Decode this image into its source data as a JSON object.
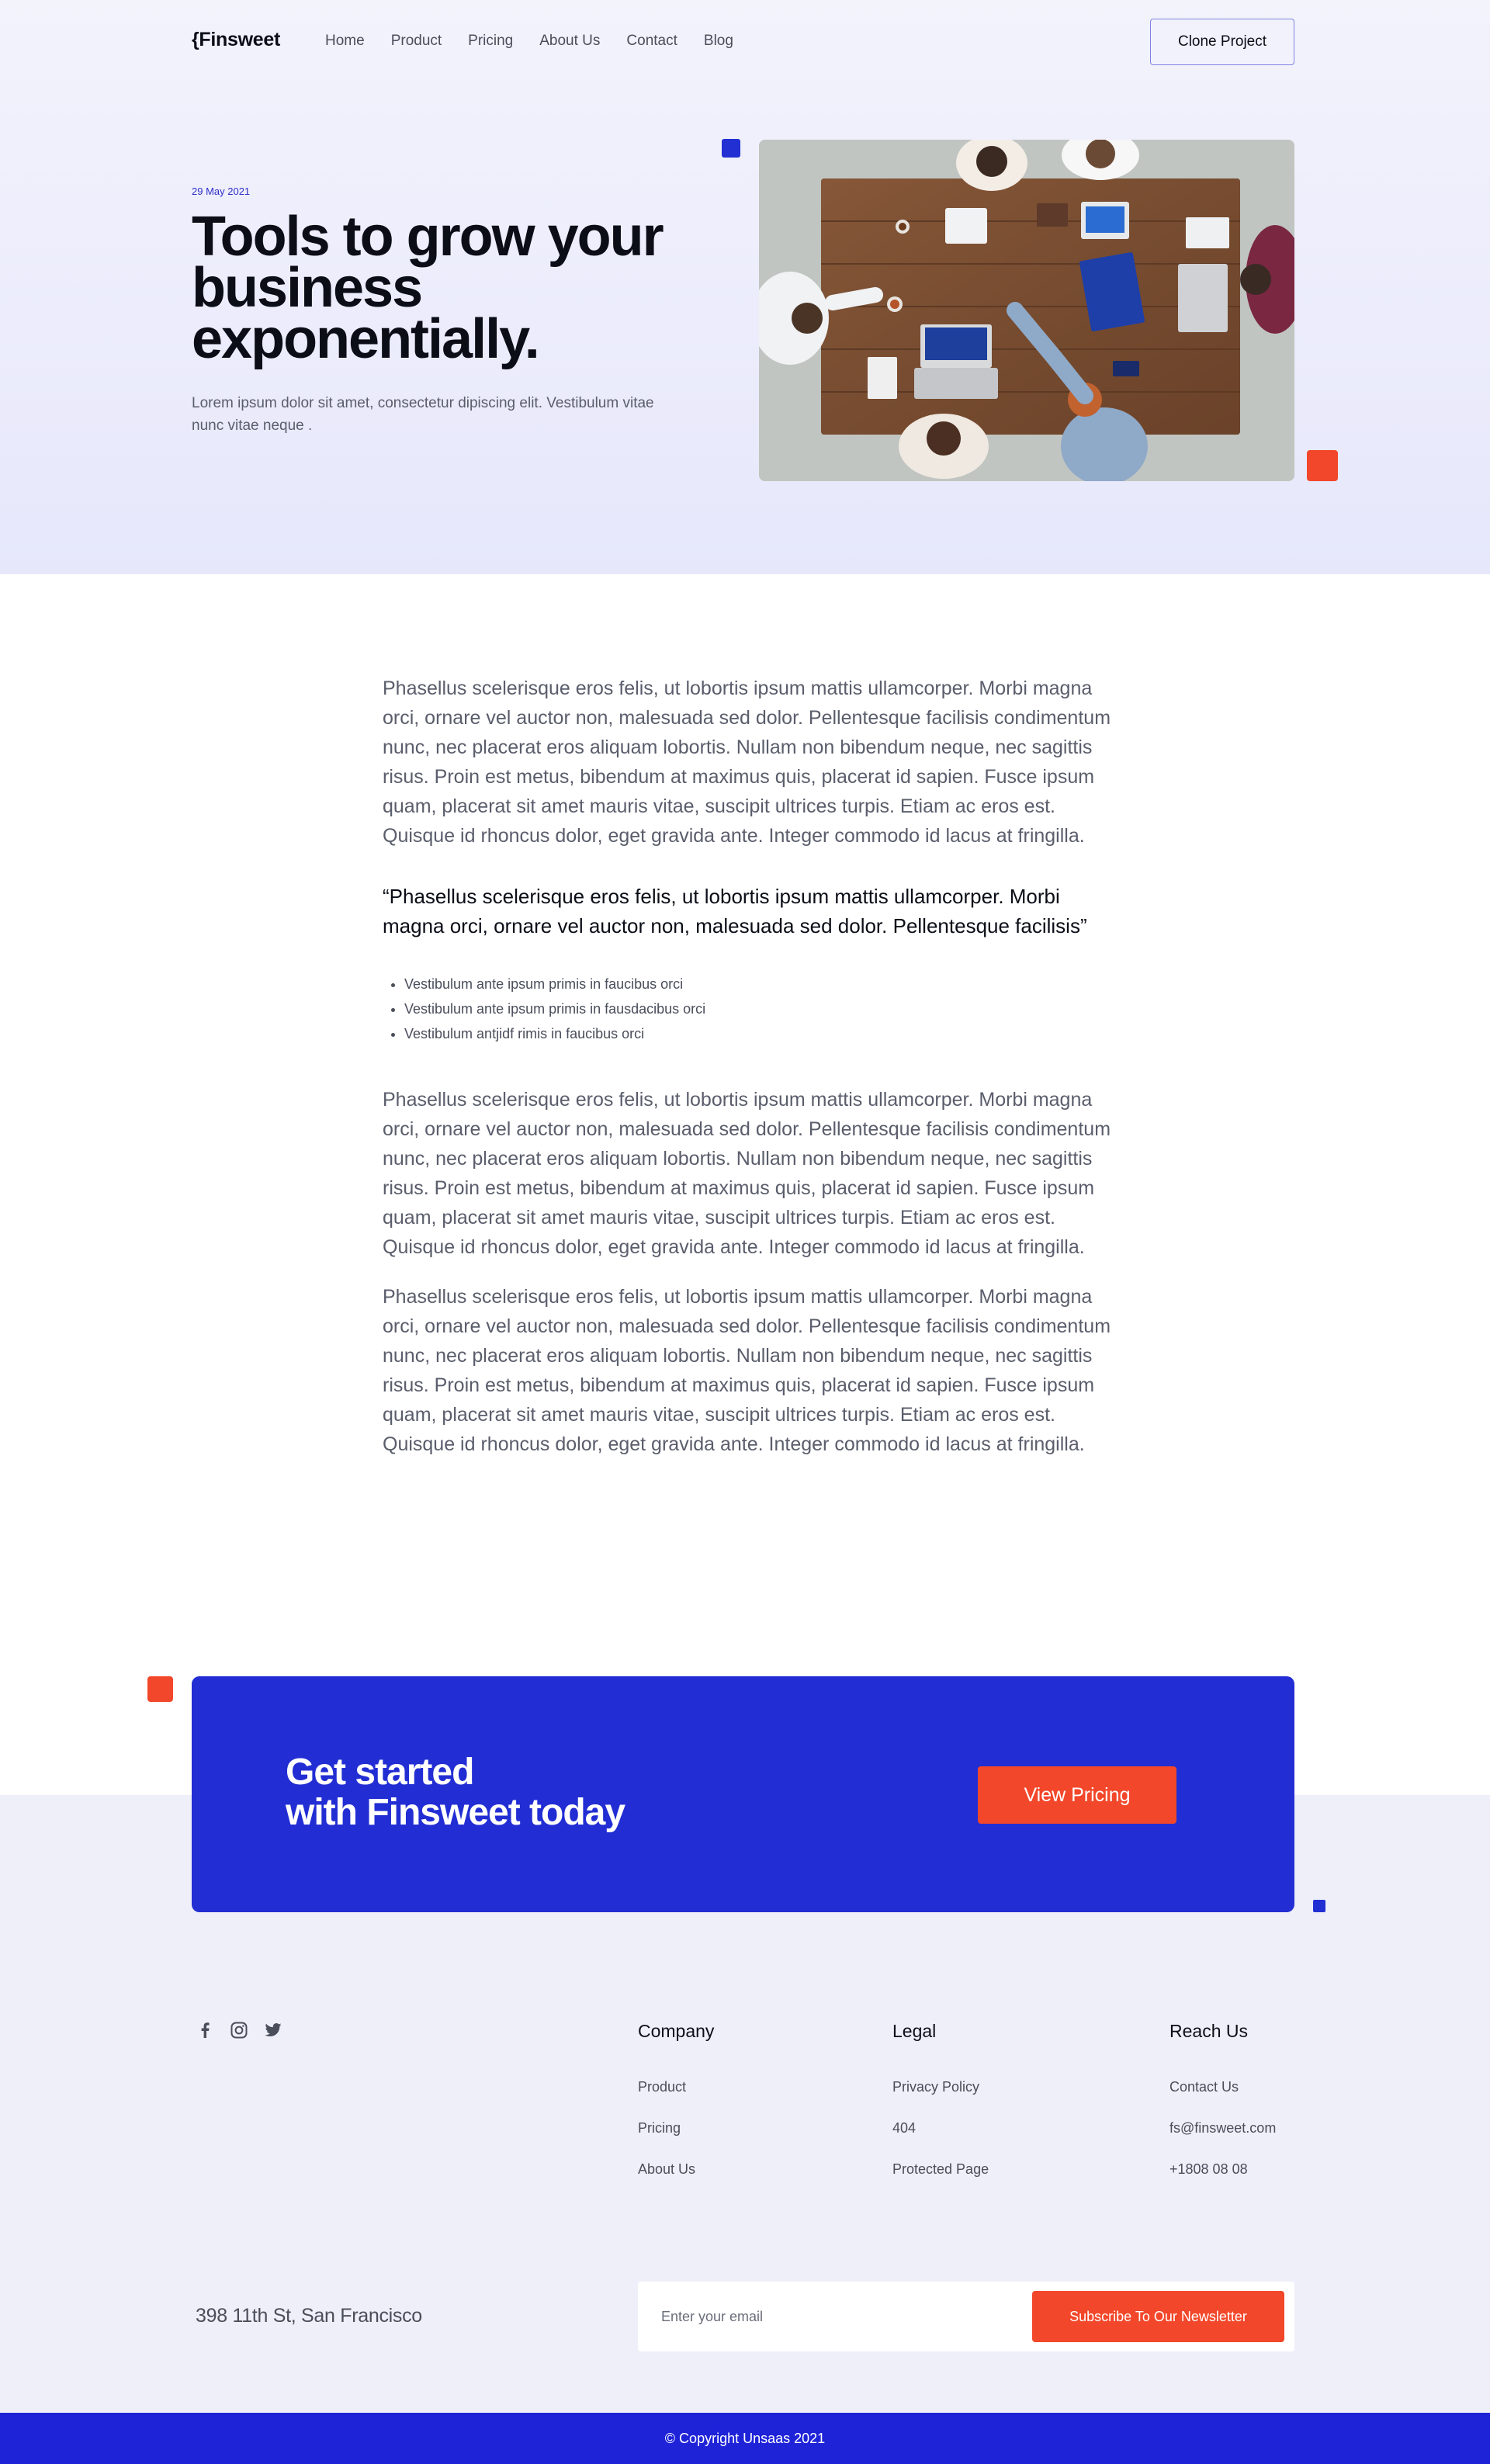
{
  "nav": {
    "logo": "{Finsweet",
    "links": [
      "Home",
      "Product",
      "Pricing",
      "About Us",
      "Contact",
      "Blog"
    ],
    "cta_label": "Clone Project"
  },
  "hero": {
    "date": "29 May 2021",
    "title": "Tools to grow your business exponentially.",
    "description": "Lorem ipsum dolor sit amet, consectetur dipiscing elit. Vestibulum vitae nunc vitae neque ."
  },
  "article": {
    "paragraph1": "Phasellus scelerisque eros felis, ut lobortis ipsum mattis ullamcorper. Morbi magna orci, ornare vel auctor non, malesuada sed dolor. Pellentesque facilisis condimentum nunc, nec placerat eros aliquam lobortis. Nullam non bibendum neque, nec sagittis risus. Proin est metus, bibendum at maximus quis, placerat id sapien. Fusce ipsum quam, placerat sit amet mauris vitae, suscipit ultrices turpis. Etiam ac eros est. Quisque id rhoncus dolor, eget gravida ante. Integer commodo id lacus at fringilla.",
    "quote": "“Phasellus scelerisque eros felis, ut lobortis ipsum mattis ullamcorper. Morbi magna orci, ornare vel auctor non, malesuada sed dolor. Pellentesque facilisis”",
    "bullets": [
      "Vestibulum ante ipsum primis in faucibus orci",
      "Vestibulum ante ipsum primis in fausdacibus orci",
      "Vestibulum antjidf rimis in faucibus orci"
    ],
    "paragraph2": "Phasellus scelerisque eros felis, ut lobortis ipsum mattis ullamcorper. Morbi magna orci, ornare vel auctor non, malesuada sed dolor. Pellentesque facilisis condimentum nunc, nec placerat eros aliquam lobortis. Nullam non bibendum neque, nec sagittis risus. Proin est metus, bibendum at maximus quis, placerat id sapien. Fusce ipsum quam, placerat sit amet mauris vitae, suscipit ultrices turpis. Etiam ac eros est. Quisque id rhoncus dolor, eget gravida ante. Integer commodo id lacus at fringilla.",
    "paragraph3": "Phasellus scelerisque eros felis, ut lobortis ipsum mattis ullamcorper. Morbi magna orci, ornare vel auctor non, malesuada sed dolor. Pellentesque facilisis condimentum nunc, nec placerat eros aliquam lobortis. Nullam non bibendum neque, nec sagittis risus. Proin est metus, bibendum at maximus quis, placerat id sapien. Fusce ipsum quam, placerat sit amet mauris vitae, suscipit ultrices turpis. Etiam ac eros est. Quisque id rhoncus dolor, eget gravida ante. Integer commodo id lacus at fringilla."
  },
  "cta": {
    "title_line1": "Get started",
    "title_line2": "with Finsweet today",
    "button": "View Pricing"
  },
  "footer": {
    "social_icons": [
      "facebook-icon",
      "instagram-icon",
      "twitter-icon"
    ],
    "columns": [
      {
        "title": "Company",
        "links": [
          "Product",
          "Pricing",
          "About Us"
        ]
      },
      {
        "title": "Legal",
        "links": [
          "Privacy Policy",
          "404",
          "Protected Page"
        ]
      },
      {
        "title": "Reach Us",
        "links": [
          "Contact Us",
          "fs@finsweet.com",
          "+1808 08 08"
        ]
      }
    ],
    "address": "398 11th St, San Francisco",
    "newsletter": {
      "placeholder": "Enter your email",
      "button": "Subscribe To Our Newsletter"
    },
    "copyright": "© Copyright Unsaas 2021"
  },
  "colors": {
    "accent_blue": "#222ed3",
    "accent_orange": "#f2472a",
    "hero_bg": "#e6e7fb",
    "footer_bg": "#efeff9"
  }
}
